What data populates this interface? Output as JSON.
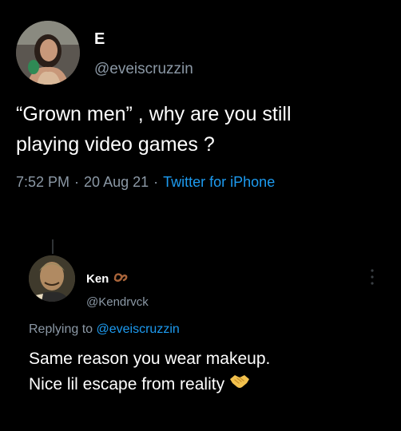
{
  "tweet": {
    "display_name": "E",
    "handle": "@eveiscruzzin",
    "text_line1": "“Grown men” , why are you still",
    "text_line2": "playing video games ?",
    "time": "7:52 PM",
    "date": "20 Aug 21",
    "source": "Twitter for iPhone"
  },
  "reply": {
    "display_name": "Ken",
    "handle": "@Kendrvck",
    "replying_prefix": "Replying to",
    "replying_mention": "@eveiscruzzin",
    "text_line1": "Same reason you wear makeup.",
    "text_line2": "Nice lil escape from reality"
  },
  "colors": {
    "background": "#000000",
    "text_primary": "#ffffff",
    "text_secondary": "#8b98a5",
    "link": "#1d9bf0"
  },
  "icons": {
    "name_badge": "pretzel-emoji-icon",
    "reply_end": "handshake-emoji-icon",
    "menu": "more-vertical-icon"
  }
}
